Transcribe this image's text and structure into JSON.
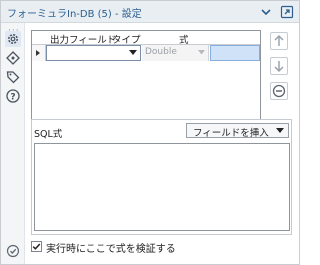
{
  "window": {
    "title": "フォーミュラIn-DB (5) - 設定",
    "accent": "#2b5f8f"
  },
  "toolbar_icons": [
    "chevron-down-icon",
    "pin-icon"
  ],
  "left_strip": [
    "configuration-gear-icon",
    "connections-icon",
    "tag-icon",
    "help-icon"
  ],
  "table": {
    "columns": [
      "出力フィールド",
      "タイプ",
      "式"
    ],
    "rows": [
      {
        "field": "",
        "type": "Double",
        "expression": ""
      }
    ]
  },
  "side_buttons": [
    "move-up-icon",
    "move-down-icon",
    "remove-icon"
  ],
  "sql": {
    "label": "SQL式",
    "insert_field_label": "フィールドを挿入",
    "text": ""
  },
  "verify": {
    "label": "実行時にここで式を検証する",
    "checked": true
  }
}
